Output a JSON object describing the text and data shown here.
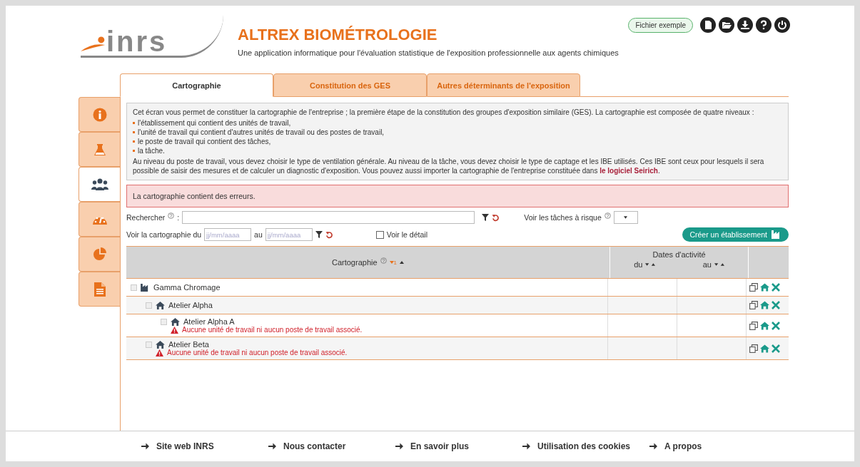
{
  "header": {
    "logo": "inrs",
    "title": "ALTREX BIOMÉTROLOGIE",
    "subtitle": "Une application informatique pour l'évaluation statistique de l'exposition professionnelle aux agents chimiques",
    "example_button": "Fichier exemple"
  },
  "tabs": [
    {
      "label": "Cartographie",
      "selected": true
    },
    {
      "label": "Constitution des GES",
      "selected": false
    },
    {
      "label": "Autres déterminants de l'exposition",
      "selected": false
    }
  ],
  "sidebar": {
    "items": [
      {
        "kind": "info",
        "selected": false
      },
      {
        "kind": "flask",
        "selected": false
      },
      {
        "kind": "people",
        "selected": true
      },
      {
        "kind": "gauge",
        "selected": false
      },
      {
        "kind": "pie",
        "selected": false
      },
      {
        "kind": "document",
        "selected": false
      }
    ]
  },
  "intro": {
    "lead": "Cet écran vous permet de constituer la cartographie de l'entreprise ; la première étape de la constitution des groupes d'exposition similaire (GES). La cartographie est composée de quatre niveaux :",
    "bullets": [
      "l'établissement qui contient des unités de travail,",
      "l'unité de travail qui contient d'autres unités de travail ou des postes de travail,",
      "le poste de travail qui contient des tâches,",
      "la tâche."
    ],
    "text": "Au niveau du poste de travail, vous devez choisir le type de ventilation générale. Au niveau de la tâche, vous devez choisir le type de captage et les IBE utilisés. Ces IBE sont ceux pour lesquels il sera possible de saisir des mesures et de calculer un diagnostic d'exposition. Vous pouvez aussi importer la cartographie de l'entreprise constituée dans",
    "link": "le logiciel Seirich",
    "after_link": "."
  },
  "error_message": "La cartographie contient des erreurs.",
  "filters": {
    "search_label": "Rechercher",
    "search_colon": ":",
    "risk_label": "Voir les tâches à risque",
    "date_label": "Voir la cartographie du",
    "date_from_placeholder": "jj/mm/aaaa",
    "date_to_label": "au",
    "date_to_placeholder": "jj/mm/aaaa",
    "detail_label": "Voir le détail",
    "detail_checked": false,
    "create_button": "Créer un établissement"
  },
  "table": {
    "columns": {
      "name": "Cartographie",
      "sort_rank": "1",
      "dates": "Dates d'activité",
      "from": "du",
      "to": "au"
    },
    "rows": [
      {
        "kind": "establishment",
        "name": "Gamma Chromage",
        "children": [
          {
            "kind": "unit",
            "name": "Atelier Alpha",
            "children": [
              {
                "kind": "unit",
                "name": "Atelier Alpha A",
                "warning": "Aucune unité de travail ni aucun poste de travail associé."
              }
            ]
          },
          {
            "kind": "unit",
            "name": "Atelier Beta",
            "warning": "Aucune unité de travail ni aucun poste de travail associé."
          }
        ]
      }
    ]
  },
  "footer": {
    "links": [
      "Site web INRS",
      "Nous contacter",
      "En savoir plus",
      "Utilisation des cookies",
      "A propos"
    ]
  }
}
